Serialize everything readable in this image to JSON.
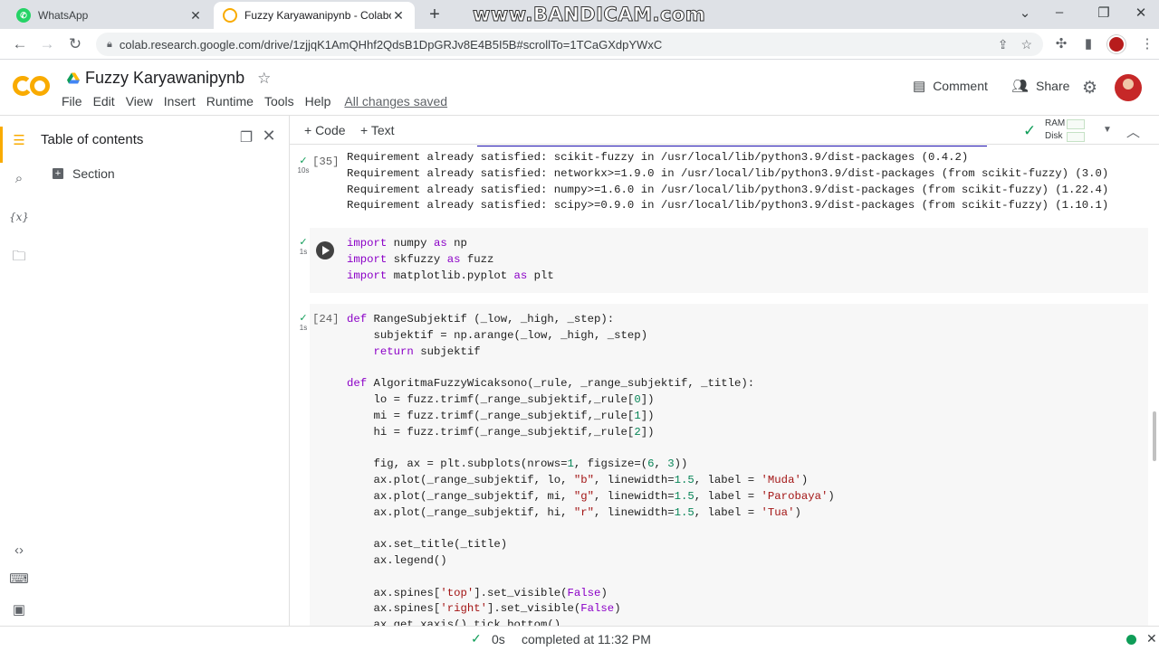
{
  "browser": {
    "tabs": [
      {
        "title": "WhatsApp",
        "icon": "whatsapp-icon",
        "active": false
      },
      {
        "title": "Fuzzy Karyawanipynb - Colabora",
        "icon": "colab-icon",
        "active": true
      }
    ],
    "new_tab_label": "+",
    "watermark": "www.BANDICAM.com",
    "url": "colab.research.google.com/drive/1zjjqK1AmQHhf2QdsB1DpGRJv8E4B5I5B#scrollTo=1TCaGXdpYWxC"
  },
  "colab": {
    "logo_text": "CO",
    "notebook_title": "Fuzzy Karyawanipynb",
    "menu": [
      "File",
      "Edit",
      "View",
      "Insert",
      "Runtime",
      "Tools",
      "Help"
    ],
    "save_status": "All changes saved",
    "comment_label": "Comment",
    "share_label": "Share"
  },
  "toc": {
    "title": "Table of contents",
    "items": [
      {
        "label": "Section"
      }
    ]
  },
  "toolbar": {
    "add_code": "+ Code",
    "add_text": "+ Text",
    "ram_label": "RAM",
    "disk_label": "Disk"
  },
  "cells": {
    "output_cell": {
      "exec_count": "[35]",
      "duration": "10s",
      "output_lines": [
        "Requirement already satisfied: scikit-fuzzy in /usr/local/lib/python3.9/dist-packages (0.4.2)",
        "Requirement already satisfied: networkx>=1.9.0 in /usr/local/lib/python3.9/dist-packages (from scikit-fuzzy) (3.0)",
        "Requirement already satisfied: numpy>=1.6.0 in /usr/local/lib/python3.9/dist-packages (from scikit-fuzzy) (1.22.4)",
        "Requirement already satisfied: scipy>=0.9.0 in /usr/local/lib/python3.9/dist-packages (from scikit-fuzzy) (1.10.1)"
      ]
    },
    "import_cell": {
      "duration": "1s",
      "lines": [
        "import numpy as np",
        "import skfuzzy as fuzz",
        "import matplotlib.pyplot as plt"
      ]
    },
    "def_cell": {
      "exec_count": "[24]",
      "duration": "1s",
      "lines": [
        "def RangeSubjektif (_low, _high, _step):",
        "    subjektif = np.arange(_low, _high, _step)",
        "    return subjektif",
        "",
        "def AlgoritmaFuzzyWicaksono(_rule, _range_subjektif, _title):",
        "    lo = fuzz.trimf(_range_subjektif,_rule[0])",
        "    mi = fuzz.trimf(_range_subjektif,_rule[1])",
        "    hi = fuzz.trimf(_range_subjektif,_rule[2])",
        "",
        "    fig, ax = plt.subplots(nrows=1, figsize=(6, 3))",
        "    ax.plot(_range_subjektif, lo, \"b\", linewidth=1.5, label = 'Muda')",
        "    ax.plot(_range_subjektif, mi, \"g\", linewidth=1.5, label = 'Parobaya')",
        "    ax.plot(_range_subjektif, hi, \"r\", linewidth=1.5, label = 'Tua')",
        "",
        "    ax.set_title(_title)",
        "    ax.legend()",
        "",
        "    ax.spines['top'].set_visible(False)",
        "    ax.spines['right'].set_visible(False)",
        "    ax.get_xaxis().tick_bottom()"
      ]
    }
  },
  "status": {
    "duration": "0s",
    "message": "completed at 11:32 PM"
  },
  "colors": {
    "accent_orange": "#f9ab00",
    "ok_green": "#0f9d58",
    "keyword_purple": "#8b00c7",
    "string_red": "#a31515"
  }
}
